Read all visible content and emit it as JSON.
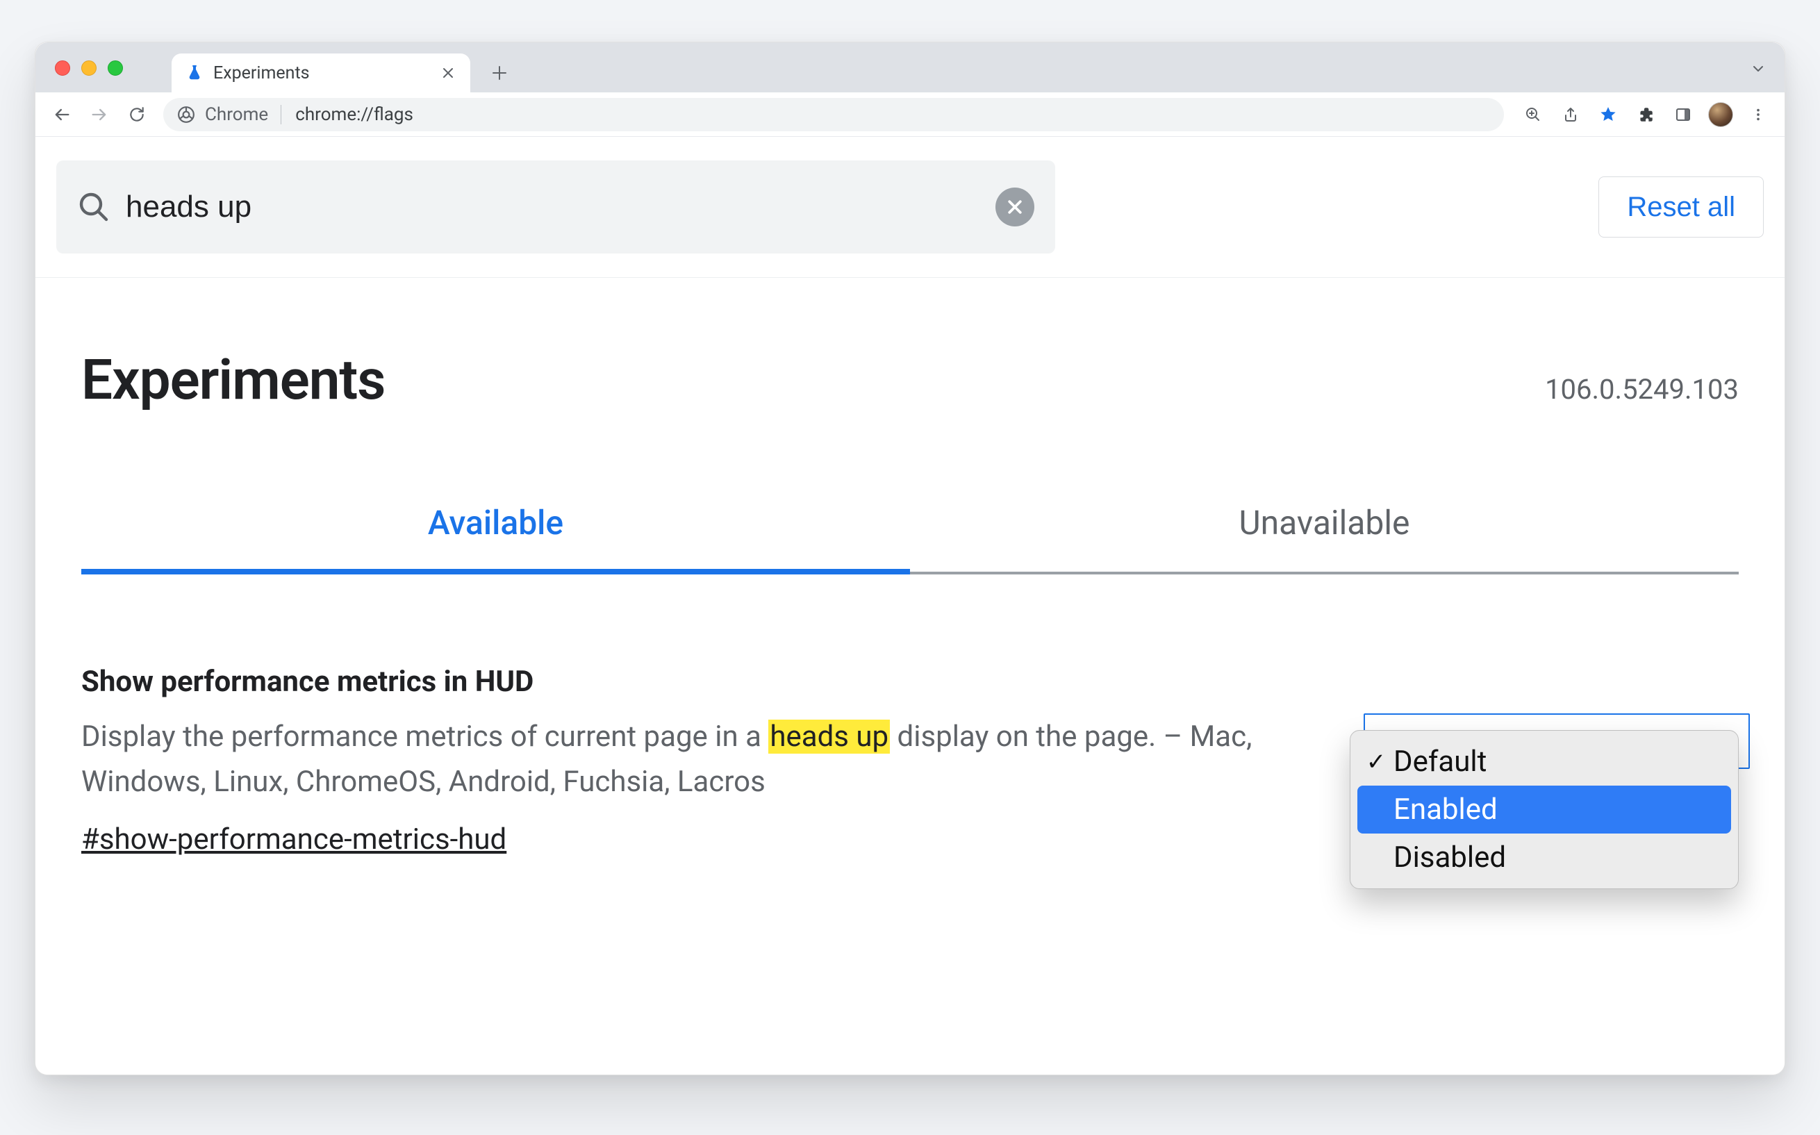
{
  "browser": {
    "tab_title": "Experiments",
    "omnibox_scheme_label": "Chrome",
    "omnibox_url": "chrome://flags"
  },
  "search": {
    "value": "heads up",
    "reset_label": "Reset all"
  },
  "header": {
    "title": "Experiments",
    "version": "106.0.5249.103"
  },
  "tabs": {
    "available": "Available",
    "unavailable": "Unavailable"
  },
  "flag": {
    "title": "Show performance metrics in HUD",
    "desc_pre": "Display the performance metrics of current page in a ",
    "desc_highlight": "heads up",
    "desc_post": " display on the page. – Mac, Windows, Linux, ChromeOS, Android, Fuchsia, Lacros",
    "anchor": "#show-performance-metrics-hud",
    "options": {
      "default": "Default",
      "enabled": "Enabled",
      "disabled": "Disabled"
    }
  }
}
